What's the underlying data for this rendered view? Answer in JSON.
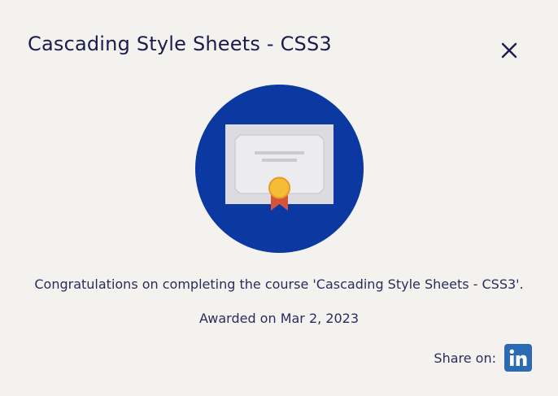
{
  "dialog": {
    "title": "Cascading Style Sheets - CSS3",
    "close_icon": "close-icon",
    "badge_icon": "certificate-icon",
    "message": "Congratulations on completing the course 'Cascading Style Sheets - CSS3'.",
    "awarded": "Awarded on Mar 2, 2023",
    "share_label": "Share on:",
    "share_icon": "linkedin-icon"
  },
  "colors": {
    "background": "#f3f2ef",
    "title_text": "#1b1c4d",
    "body_text": "#2b2c5e",
    "badge_circle": "#0c38a1",
    "certificate_paper": "#dfdfe3",
    "medal_gold": "#f5bd35",
    "ribbon_red": "#d4553c",
    "linkedin_blue": "#2a6bb3"
  }
}
